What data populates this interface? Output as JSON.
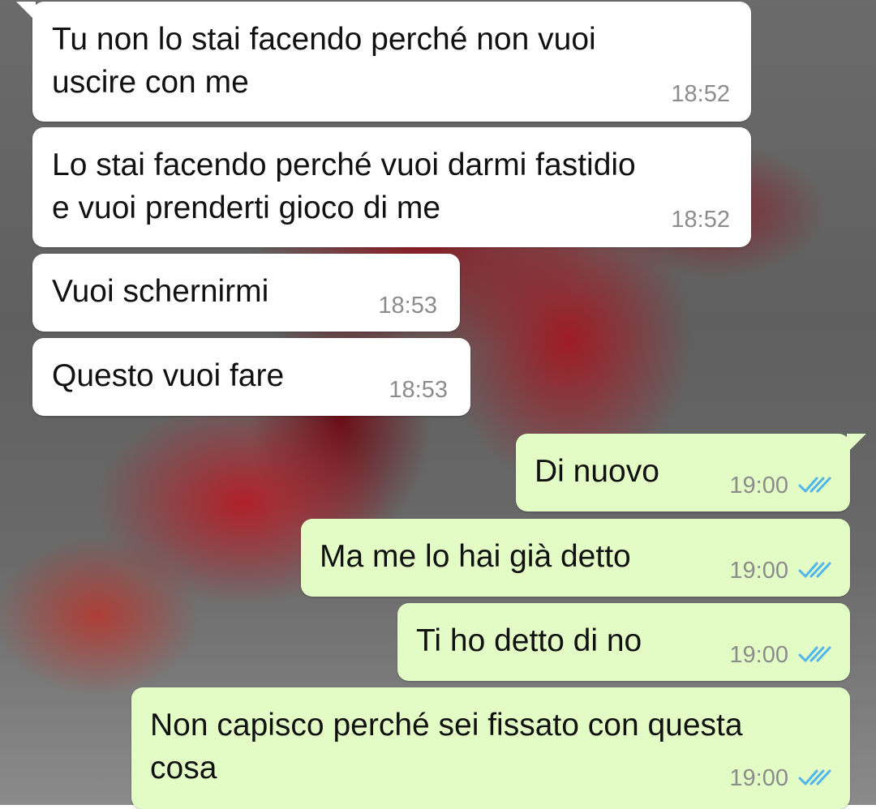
{
  "messages": [
    {
      "direction": "incoming",
      "text": "Tu non lo stai facendo perché non vuoi\nuscire con me",
      "time": "18:52"
    },
    {
      "direction": "incoming",
      "text": "Lo stai facendo perché vuoi darmi fastidio\ne vuoi prenderti gioco di me",
      "time": "18:52"
    },
    {
      "direction": "incoming",
      "text": "Vuoi schernirmi",
      "time": "18:53"
    },
    {
      "direction": "incoming",
      "text": "Questo vuoi fare",
      "time": "18:53"
    },
    {
      "direction": "outgoing",
      "text": "Di nuovo",
      "time": "19:00",
      "status": "read"
    },
    {
      "direction": "outgoing",
      "text": "Ma me lo hai già detto",
      "time": "19:00",
      "status": "read"
    },
    {
      "direction": "outgoing",
      "text": "Ti ho detto di no",
      "time": "19:00",
      "status": "read"
    },
    {
      "direction": "outgoing",
      "text": "Non capisco perché sei fissato con questa\ncosa",
      "time": "19:00",
      "status": "read"
    }
  ],
  "colors": {
    "incoming_bubble": "#ffffff",
    "outgoing_bubble": "#e3fcc5",
    "timestamp": "#8c8c8c",
    "read_ticks": "#4fb6ec"
  },
  "icons": {
    "read_receipt": "double-check-icon"
  }
}
